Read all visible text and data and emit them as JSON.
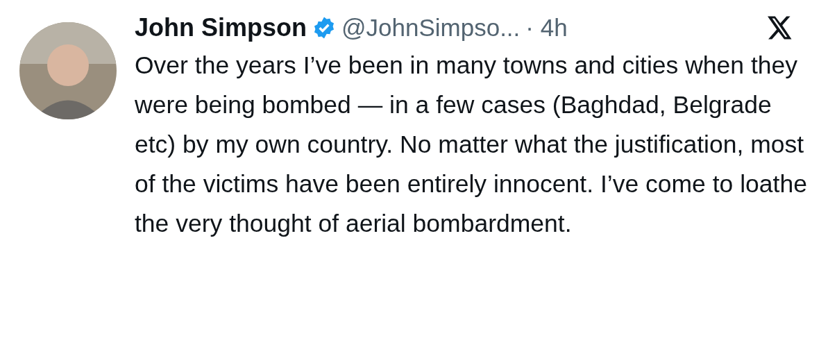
{
  "post": {
    "author": {
      "name": "John Simpson",
      "verified": true,
      "handle": "@JohnSimpso...",
      "time": "· 4h"
    },
    "text": "Over the years I’ve been in many towns and cities when they were being bombed — in a few cases (Baghdad, Belgrade etc) by my own country. No matter what the justification, most of the victims have been entirely innocent. I’ve come to loathe the very thought of aerial bombardment."
  }
}
